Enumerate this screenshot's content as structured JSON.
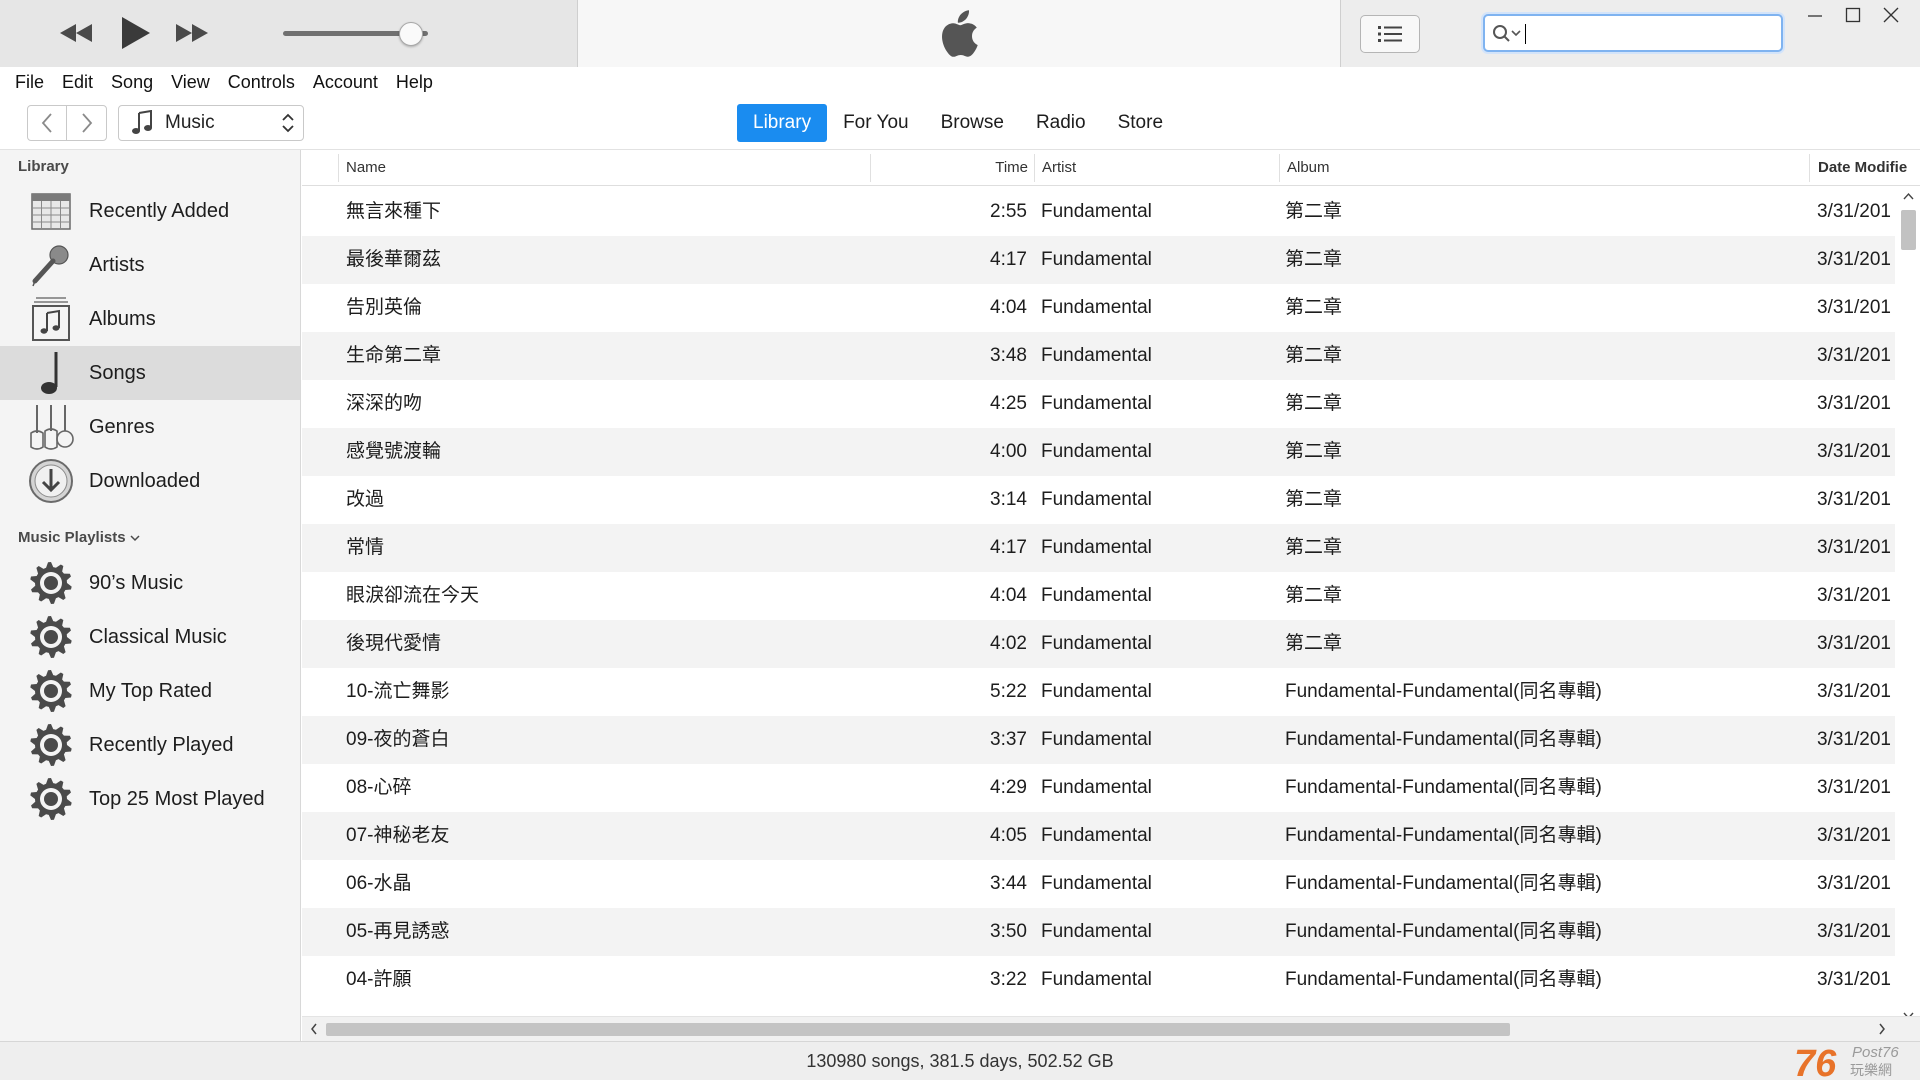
{
  "menu": [
    "File",
    "Edit",
    "Song",
    "View",
    "Controls",
    "Account",
    "Help"
  ],
  "media_selector": {
    "label": "Music"
  },
  "tabs": [
    {
      "label": "Library",
      "active": true
    },
    {
      "label": "For You",
      "active": false
    },
    {
      "label": "Browse",
      "active": false
    },
    {
      "label": "Radio",
      "active": false
    },
    {
      "label": "Store",
      "active": false
    }
  ],
  "search": {
    "value": "",
    "placeholder": ""
  },
  "sidebar": {
    "library_heading": "Library",
    "library_items": [
      {
        "label": "Recently Added",
        "icon": "calendar-grid-icon"
      },
      {
        "label": "Artists",
        "icon": "microphone-icon"
      },
      {
        "label": "Albums",
        "icon": "album-note-icon"
      },
      {
        "label": "Songs",
        "icon": "music-note-icon",
        "selected": true
      },
      {
        "label": "Genres",
        "icon": "guitars-icon"
      },
      {
        "label": "Downloaded",
        "icon": "download-circle-icon"
      }
    ],
    "playlists_heading": "Music Playlists",
    "playlists": [
      {
        "label": "90’s Music",
        "icon": "gear-icon"
      },
      {
        "label": "Classical Music",
        "icon": "gear-icon"
      },
      {
        "label": "My Top Rated",
        "icon": "gear-icon"
      },
      {
        "label": "Recently Played",
        "icon": "gear-icon"
      },
      {
        "label": "Top 25 Most Played",
        "icon": "gear-icon"
      }
    ]
  },
  "table": {
    "columns": {
      "name": "Name",
      "time": "Time",
      "artist": "Artist",
      "album": "Album",
      "date": "Date Modifie"
    },
    "rows": [
      {
        "name": "無言來種下",
        "time": "2:55",
        "artist": "Fundamental",
        "album": "第二章",
        "date": "3/31/201"
      },
      {
        "name": "最後華爾茲",
        "time": "4:17",
        "artist": "Fundamental",
        "album": "第二章",
        "date": "3/31/201"
      },
      {
        "name": "告別英倫",
        "time": "4:04",
        "artist": "Fundamental",
        "album": "第二章",
        "date": "3/31/201"
      },
      {
        "name": "生命第二章",
        "time": "3:48",
        "artist": "Fundamental",
        "album": "第二章",
        "date": "3/31/201"
      },
      {
        "name": "深深的吻",
        "time": "4:25",
        "artist": "Fundamental",
        "album": "第二章",
        "date": "3/31/201"
      },
      {
        "name": "感覺號渡輪",
        "time": "4:00",
        "artist": "Fundamental",
        "album": "第二章",
        "date": "3/31/201"
      },
      {
        "name": "改過",
        "time": "3:14",
        "artist": "Fundamental",
        "album": "第二章",
        "date": "3/31/201"
      },
      {
        "name": "常情",
        "time": "4:17",
        "artist": "Fundamental",
        "album": "第二章",
        "date": "3/31/201"
      },
      {
        "name": "眼淚卻流在今天",
        "time": "4:04",
        "artist": "Fundamental",
        "album": "第二章",
        "date": "3/31/201"
      },
      {
        "name": "後現代愛情",
        "time": "4:02",
        "artist": "Fundamental",
        "album": "第二章",
        "date": "3/31/201"
      },
      {
        "name": "10-流亡舞影",
        "time": "5:22",
        "artist": "Fundamental",
        "album": "Fundamental-Fundamental(同名專輯)",
        "date": "3/31/201"
      },
      {
        "name": "09-夜的蒼白",
        "time": "3:37",
        "artist": "Fundamental",
        "album": "Fundamental-Fundamental(同名專輯)",
        "date": "3/31/201"
      },
      {
        "name": "08-心碎",
        "time": "4:29",
        "artist": "Fundamental",
        "album": "Fundamental-Fundamental(同名專輯)",
        "date": "3/31/201"
      },
      {
        "name": "07-神秘老友",
        "time": "4:05",
        "artist": "Fundamental",
        "album": "Fundamental-Fundamental(同名專輯)",
        "date": "3/31/201"
      },
      {
        "name": "06-水晶",
        "time": "3:44",
        "artist": "Fundamental",
        "album": "Fundamental-Fundamental(同名專輯)",
        "date": "3/31/201"
      },
      {
        "name": "05-再見誘惑",
        "time": "3:50",
        "artist": "Fundamental",
        "album": "Fundamental-Fundamental(同名專輯)",
        "date": "3/31/201"
      },
      {
        "name": "04-許願",
        "time": "3:22",
        "artist": "Fundamental",
        "album": "Fundamental-Fundamental(同名專輯)",
        "date": "3/31/201"
      }
    ]
  },
  "volume_level": 0.88,
  "status": {
    "summary": "130980 songs, 381.5 days, 502.52 GB"
  },
  "watermark": {
    "text": "76 Post76 玩樂網"
  },
  "colors": {
    "accent": "#1a8cf0",
    "selected_row": "#dcdcdc",
    "alt_row": "#f3f3f3"
  }
}
